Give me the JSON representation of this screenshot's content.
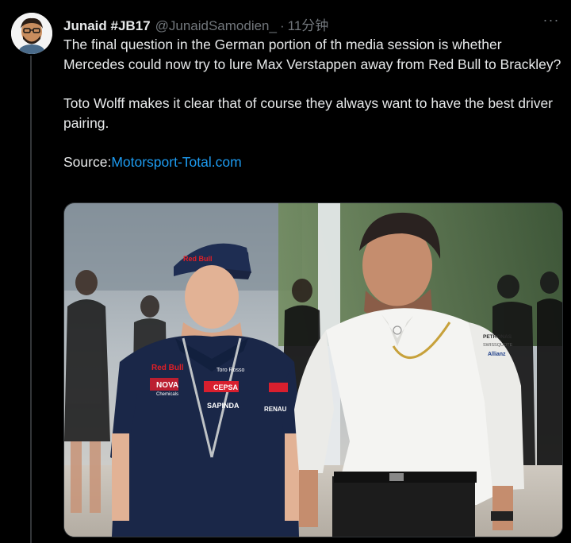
{
  "author": {
    "display_name": "Junaid #JB17",
    "handle": "@JunaidSamodien_",
    "separator": "·",
    "time": "11分钟"
  },
  "more_label": "···",
  "tweet": {
    "paragraph_1": "The final question in the German portion of th media session is whether Mercedes could now try to lure Max Verstappen away from Red Bull to Brackley?",
    "paragraph_2": "Toto Wolff makes it clear that of course they always want to have the best driver pairing.",
    "source_label": "Source:",
    "source_link": "Motorsport-Total.com"
  },
  "photo": {
    "cap_logo": "Red Bull",
    "shirt_logo_redbull": "Red Bull",
    "shirt_logo_nova": "NOVA",
    "shirt_logo_nova_sub": "Chemicals",
    "shirt_logo_cepsa": "CEPSA",
    "shirt_logo_sapinda": "SAPINDA",
    "shirt_logo_toro": "Toro Rosso",
    "shirt_logo_renault": "RENAU",
    "shirt_logo_petronas": "PETRONAS",
    "shirt_logo_swiss": "SWISSQUOTE",
    "shirt_logo_allianz": "Allianz"
  }
}
